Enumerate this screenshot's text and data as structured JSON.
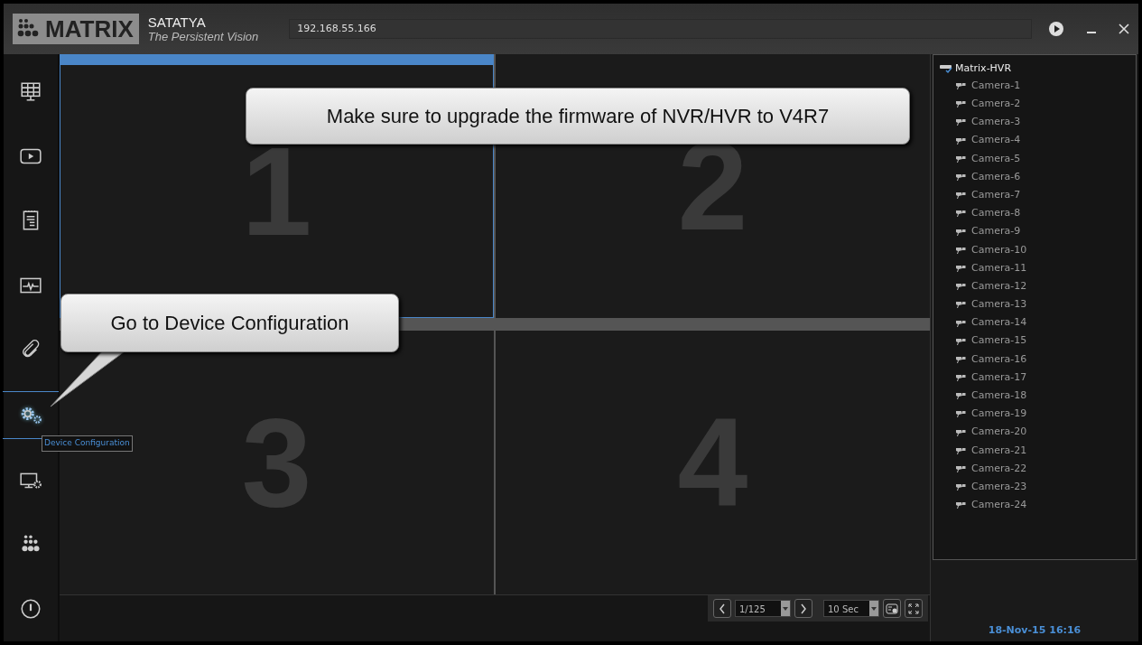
{
  "header": {
    "brand": "MATRIX",
    "product": "SATATYA",
    "tagline": "The Persistent Vision",
    "address": "192.168.55.166"
  },
  "sidebar": {
    "items": [
      {
        "kind": "layout",
        "selected": false
      },
      {
        "kind": "playback",
        "selected": false
      },
      {
        "kind": "report",
        "selected": false
      },
      {
        "kind": "health",
        "selected": false
      },
      {
        "kind": "attach",
        "selected": false
      },
      {
        "kind": "config",
        "selected": true
      },
      {
        "kind": "display",
        "selected": false
      },
      {
        "kind": "about",
        "selected": false
      },
      {
        "kind": "power",
        "selected": false
      }
    ],
    "tooltip": "Device Configuration"
  },
  "panes": [
    {
      "label": "1",
      "selected": true
    },
    {
      "label": "2",
      "selected": false
    },
    {
      "label": "3",
      "selected": false
    },
    {
      "label": "4",
      "selected": false
    }
  ],
  "toolbar": {
    "page": "1/125",
    "interval": "10 Sec"
  },
  "tree": {
    "device": "Matrix-HVR",
    "cameras": [
      "Camera-1",
      "Camera-2",
      "Camera-3",
      "Camera-4",
      "Camera-5",
      "Camera-6",
      "Camera-7",
      "Camera-8",
      "Camera-9",
      "Camera-10",
      "Camera-11",
      "Camera-12",
      "Camera-13",
      "Camera-14",
      "Camera-15",
      "Camera-16",
      "Camera-17",
      "Camera-18",
      "Camera-19",
      "Camera-20",
      "Camera-21",
      "Camera-22",
      "Camera-23",
      "Camera-24"
    ]
  },
  "datetime": "18-Nov-15 16:16",
  "callouts": [
    "Make sure to upgrade the firmware of NVR/HVR to V4R7",
    "Go to Device Configuration"
  ]
}
